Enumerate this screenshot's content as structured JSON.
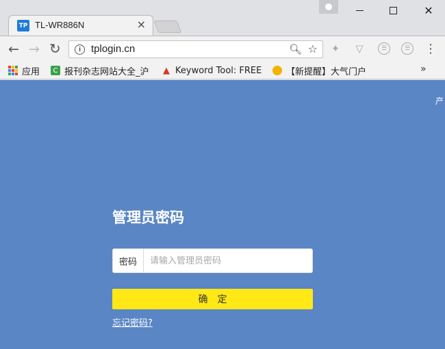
{
  "browser": {
    "tab": {
      "favicon_text": "TP",
      "title": "TL-WR886N",
      "close": "×"
    },
    "window_controls": {
      "close": "✕"
    },
    "address_bar": {
      "url": "tplogin.cn",
      "info": "i"
    },
    "bookmarks": {
      "apps_label": "应用",
      "items": [
        {
          "label": "报刊杂志网站大全_沪",
          "favicon_color": "#3aa34a"
        },
        {
          "label": "Keyword Tool: FREE",
          "favicon_color": "#d23a26"
        },
        {
          "label": "【新提醒】大气门户",
          "favicon_color": "#f2b400"
        }
      ],
      "overflow": "»"
    },
    "colors": {
      "accent_blue": "#1f7bd6"
    }
  },
  "page": {
    "corner_text": "产",
    "login": {
      "title": "管理员密码",
      "password_label": "密码",
      "password_placeholder": "请输入管理员密码",
      "password_value": "",
      "confirm_label": "确定",
      "forgot_link": "忘记密码?"
    },
    "colors": {
      "background": "#5a86c5",
      "confirm_button": "#ffe815"
    }
  }
}
